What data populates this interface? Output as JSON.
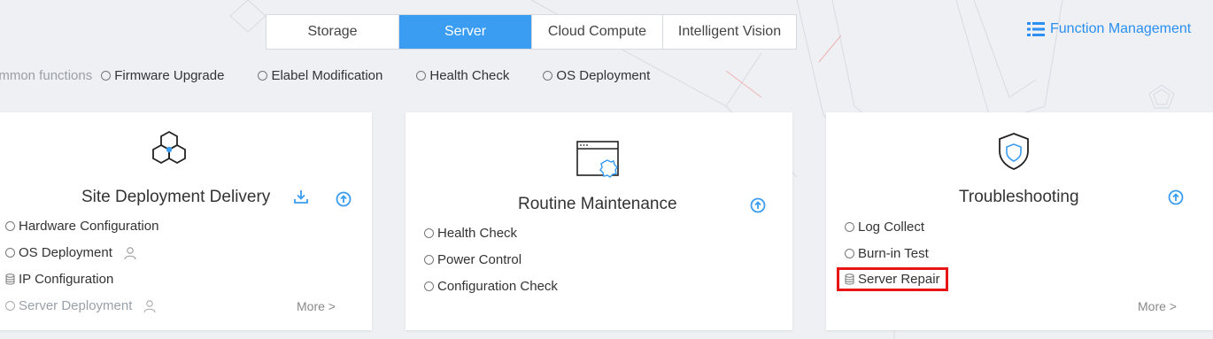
{
  "tabs": [
    {
      "label": "Storage",
      "active": false
    },
    {
      "label": "Server",
      "active": true
    },
    {
      "label": "Cloud Compute",
      "active": false
    },
    {
      "label": "Intelligent Vision",
      "active": false
    }
  ],
  "function_management": {
    "label": "Function Management",
    "icon": "list-icon"
  },
  "common_functions": {
    "label": "ommon functions",
    "items": [
      "Firmware Upgrade",
      "Elabel Modification",
      "Health Check",
      "OS Deployment"
    ]
  },
  "cards": {
    "site": {
      "title": "Site Deployment Delivery",
      "icon": "hexagon-cluster-icon",
      "items": [
        {
          "label": "Hardware Configuration",
          "icon": "radio"
        },
        {
          "label": "OS Deployment",
          "icon": "radio",
          "extra": "user-icon"
        },
        {
          "label": "IP Configuration",
          "icon": "database-icon"
        },
        {
          "label": "Server Deployment",
          "icon": "radio",
          "extra": "user-icon",
          "muted": true
        }
      ],
      "more": "More >"
    },
    "routine": {
      "title": "Routine Maintenance",
      "icon": "window-gear-icon",
      "items": [
        {
          "label": "Health Check",
          "icon": "radio"
        },
        {
          "label": "Power Control",
          "icon": "radio"
        },
        {
          "label": "Configuration Check",
          "icon": "radio"
        }
      ]
    },
    "trouble": {
      "title": "Troubleshooting",
      "icon": "shield-icon",
      "items": [
        {
          "label": "Log Collect",
          "icon": "radio"
        },
        {
          "label": "Burn-in Test",
          "icon": "radio"
        },
        {
          "label": "Server Repair",
          "icon": "database-icon",
          "highlighted": true
        }
      ],
      "more": "More >"
    }
  },
  "colors": {
    "accent": "#3b9df2",
    "highlight": "#e81515",
    "background": "#eef0f4"
  }
}
